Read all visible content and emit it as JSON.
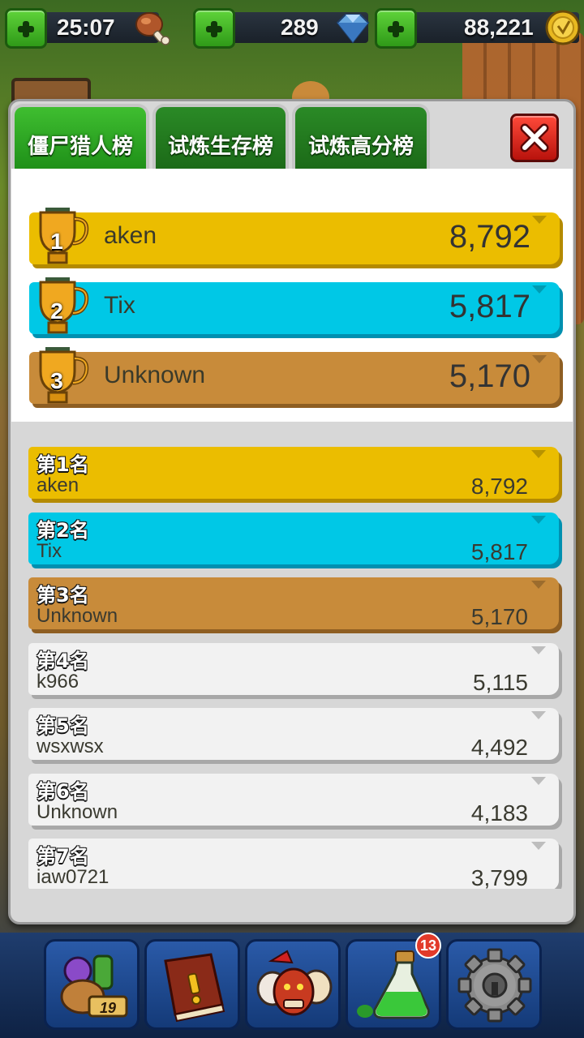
{
  "resources": {
    "energy": {
      "value": "25:07",
      "icon": "meat-drumstick-icon"
    },
    "gems": {
      "value": "289",
      "icon": "diamond-icon"
    },
    "coins": {
      "value": "88,221",
      "icon": "gold-coin-icon"
    }
  },
  "tabs": [
    {
      "label": "僵尸猎人榜",
      "active": true
    },
    {
      "label": "试炼生存榜",
      "active": false
    },
    {
      "label": "试炼高分榜",
      "active": false
    }
  ],
  "top3": [
    {
      "rank": "1",
      "name": "aken",
      "score": "8,792"
    },
    {
      "rank": "2",
      "name": "Tix",
      "score": "5,817"
    },
    {
      "rank": "3",
      "name": "Unknown",
      "score": "5,170"
    }
  ],
  "leaderboard": [
    {
      "rank": "第1名",
      "name": "aken",
      "score": "8,792"
    },
    {
      "rank": "第2名",
      "name": "Tix",
      "score": "5,817"
    },
    {
      "rank": "第3名",
      "name": "Unknown",
      "score": "5,170"
    },
    {
      "rank": "第4名",
      "name": "k966",
      "score": "5,115"
    },
    {
      "rank": "第5名",
      "name": "wsxwsx",
      "score": "4,492"
    },
    {
      "rank": "第6名",
      "name": "Unknown",
      "score": "4,183"
    },
    {
      "rank": "第7名",
      "name": "iaw0721",
      "score": "3,799"
    }
  ],
  "dock": {
    "calendar_day": "19",
    "potion_badge": "13",
    "items": [
      "backpack-icon",
      "book-icon",
      "heroes-icon",
      "potion-icon",
      "settings-gear-icon"
    ]
  },
  "colors": {
    "gold": "#ebbd00",
    "cyan": "#00c8e6",
    "bronze": "#c88b3a",
    "tab_green": "#1e8f18",
    "close_red": "#d8201a"
  }
}
